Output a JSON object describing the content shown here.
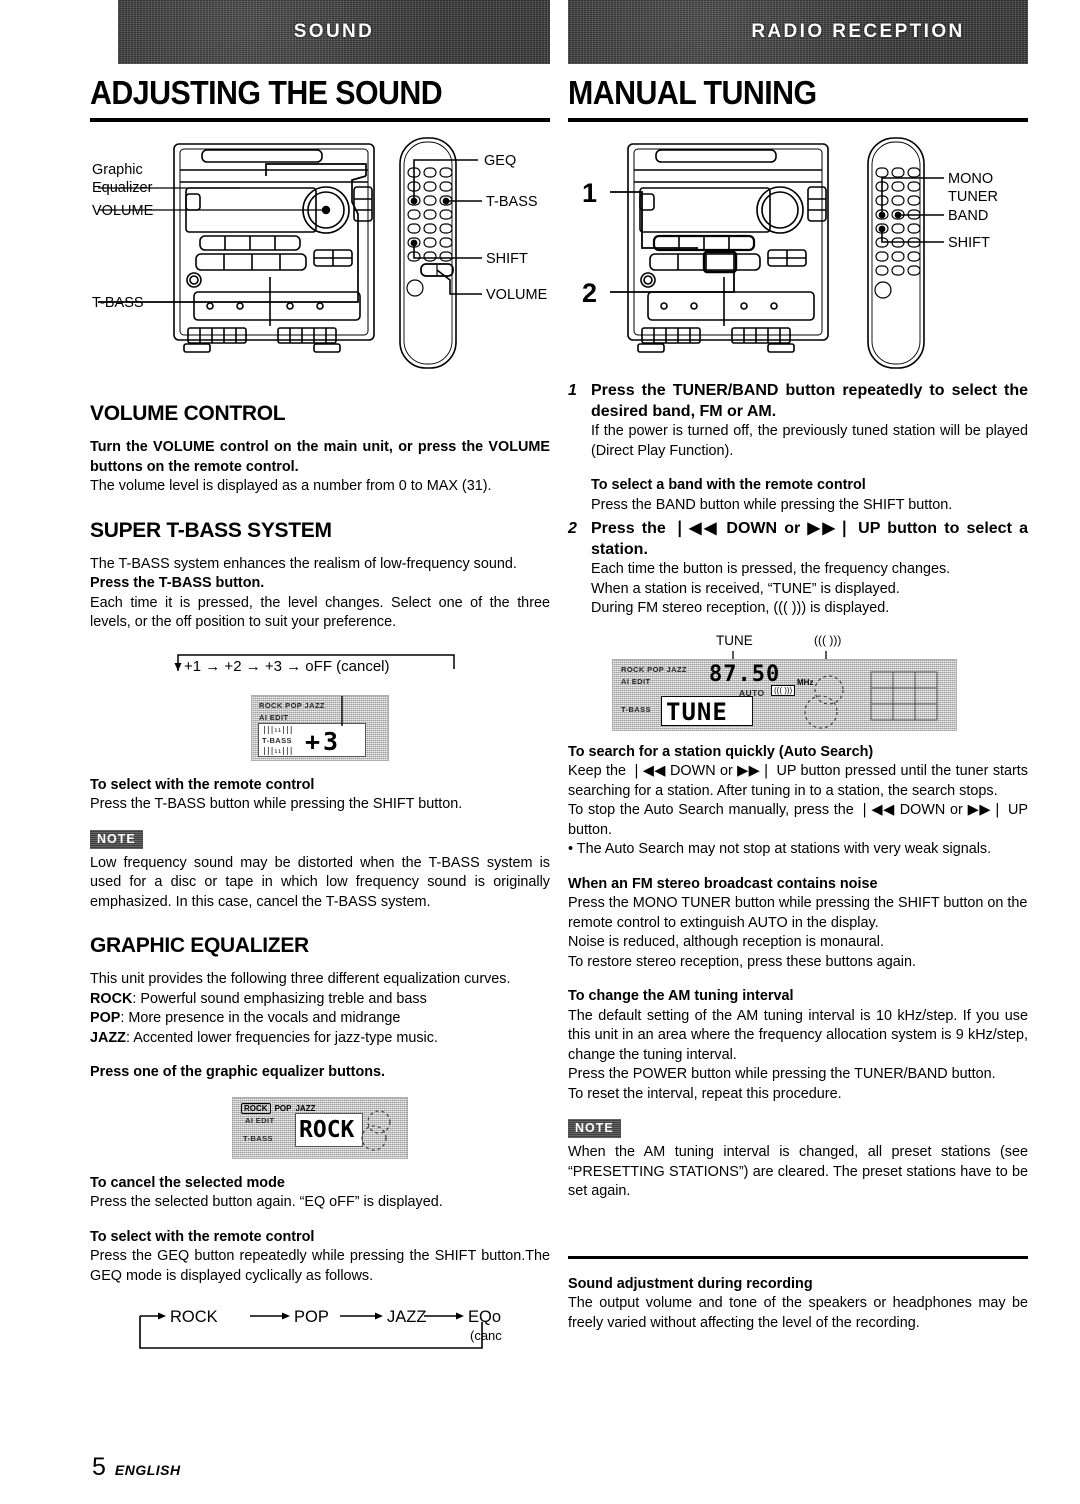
{
  "page": {
    "number": "5",
    "language_label": "ENGLISH"
  },
  "left": {
    "banner": "SOUND",
    "title": "ADJUSTING THE SOUND",
    "diagram": {
      "callouts": [
        {
          "name": "graphic-equalizer",
          "line1": "Graphic",
          "line2": "Equalizer"
        },
        {
          "name": "volume-main",
          "line1": "VOLUME"
        },
        {
          "name": "t-bass-main",
          "line1": "T-BASS"
        },
        {
          "name": "geq-remote",
          "line1": "GEQ"
        },
        {
          "name": "t-bass-remote",
          "line1": "T-BASS"
        },
        {
          "name": "shift-remote",
          "line1": "SHIFT"
        },
        {
          "name": "volume-remote",
          "line1": "VOLUME"
        }
      ]
    },
    "volume_control": {
      "heading": "VOLUME CONTROL",
      "bold_instruction": "Turn the VOLUME control on the main unit, or press the VOLUME buttons on the remote control.",
      "body": "The volume level is displayed as a number from 0 to MAX (31)."
    },
    "super_tbass": {
      "heading": "SUPER T-BASS SYSTEM",
      "body1": "The T-BASS system enhances the realism of low-frequency sound.",
      "bold_instruction": "Press the T-BASS button.",
      "body2": "Each time it is pressed, the level changes.  Select one of the three levels, or the off position to suit your preference.",
      "cycle": "+1 → +2 → +3 → oFF (cancel)",
      "cycle_steps": [
        "+1",
        "+2",
        "+3",
        "oFF (cancel)"
      ],
      "display": {
        "modes": "ROCK  POP  JAZZ",
        "edit": "AI EDIT",
        "tbass": "T-BASS",
        "value": "+3"
      },
      "remote_heading": "To select with the remote control",
      "remote_body": "Press the T-BASS button while pressing the SHIFT button.",
      "note_label": "NOTE",
      "note_body": "Low frequency sound may be distorted when the T-BASS system is used for a disc or tape in which low frequency sound is originally emphasized. In this case, cancel the T-BASS system."
    },
    "graphic_equalizer": {
      "heading": "GRAPHIC EQUALIZER",
      "intro": "This unit provides the following three different equalization curves.",
      "curves": [
        {
          "name": "ROCK",
          "desc": "Powerful sound emphasizing treble and bass"
        },
        {
          "name": "POP",
          "desc": "More presence in the vocals and midrange"
        },
        {
          "name": "JAZZ",
          "desc": "Accented lower frequencies for jazz-type music."
        }
      ],
      "bold_instruction": "Press one of the graphic equalizer buttons.",
      "display": {
        "modes_rock": "ROCK",
        "modes_pop": "POP",
        "modes_jazz": "JAZZ",
        "edit": "AI EDIT",
        "tbass": "T-BASS",
        "value": "ROCK"
      },
      "cancel_heading": "To cancel the selected mode",
      "cancel_body": "Press the selected button again. “EQ oFF” is displayed.",
      "remote_heading": "To select with the remote control",
      "remote_body": "Press the GEQ button repeatedly while pressing the SHIFT button.The GEQ mode is displayed cyclically as follows.",
      "cycle_steps": [
        "ROCK",
        "POP",
        "JAZZ",
        "EQoFF"
      ],
      "cycle_last_sub": "(cancel)"
    }
  },
  "right": {
    "banner": "RADIO RECEPTION",
    "title": "MANUAL TUNING",
    "diagram": {
      "callouts": [
        {
          "name": "step-1",
          "line1": "1"
        },
        {
          "name": "step-2",
          "line1": "2"
        },
        {
          "name": "mono-tuner-remote",
          "line1": "MONO",
          "line2": "TUNER"
        },
        {
          "name": "band-remote",
          "line1": "BAND"
        },
        {
          "name": "shift-remote",
          "line1": "SHIFT"
        }
      ]
    },
    "step1": {
      "num": "1",
      "head": "Press the TUNER/BAND button repeatedly to select the desired band, FM or AM.",
      "body": "If the power is turned off, the previously tuned station will be played (Direct Play Function).",
      "sub_heading": "To select a band with the remote control",
      "sub_body": "Press the BAND button while pressing the SHIFT button."
    },
    "step2": {
      "num": "2",
      "head_pre": "Press the ",
      "head_down": "DOWN or",
      "head_up": "UP button to select a station.",
      "head_full": "Press the ❘◀◀  DOWN or ▶▶❘ UP button to select a station.",
      "body1": "Each time the button is pressed, the frequency changes.",
      "body2": "When a station is received, “TUNE” is displayed.",
      "body3": "During FM stereo reception, ((( ))) is displayed."
    },
    "tune_display": {
      "pointer_tune": "TUNE",
      "pointer_stereo": "((( )))",
      "modes": "ROCK  POP  JAZZ",
      "edit": "AI EDIT",
      "tbass": "T-BASS",
      "frequency": "87.50",
      "unit": "MHz",
      "auto": "AUTO",
      "tune_text": "TUNE"
    },
    "auto_search": {
      "heading": "To search for a station quickly (Auto Search)",
      "body1": "Keep the ❘◀◀ DOWN or ▶▶❘ UP button pressed until the tuner starts searching for a station.  After tuning in to a station, the search stops.",
      "body2": "To stop the Auto Search manually, press the ❘◀◀ DOWN or ▶▶❘ UP button.",
      "bullet": "• The Auto Search may not stop at stations with very weak signals."
    },
    "fm_noise": {
      "heading": "When an FM stereo broadcast contains noise",
      "body1": "Press the MONO TUNER button while pressing the SHIFT button on the remote control to extinguish AUTO in the display.",
      "body2": "Noise is reduced, although reception is monaural.",
      "body3": "To restore stereo reception, press these buttons again."
    },
    "am_interval": {
      "heading": "To change the AM tuning interval",
      "body1": "The default setting of the AM tuning interval is 10 kHz/step.  If you use this unit in an area where the frequency allocation system is 9 kHz/step, change the tuning interval.",
      "body2": "Press the POWER button while pressing the TUNER/BAND button.",
      "body3": "To reset the interval, repeat this procedure.",
      "note_label": "NOTE",
      "note_body": "When the AM tuning interval is changed, all preset stations (see “PRESETTING STATIONS”) are cleared.  The preset stations have to be set again."
    },
    "recording": {
      "heading": "Sound adjustment during recording",
      "body": "The output volume and tone of the speakers or headphones may be freely varied without affecting the level of the recording."
    }
  }
}
